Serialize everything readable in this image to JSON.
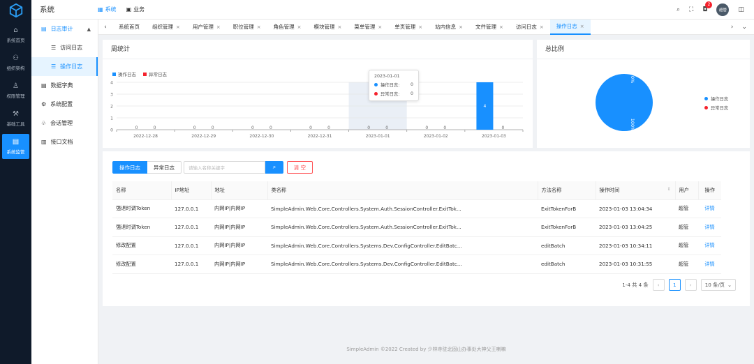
{
  "rail": {
    "items": [
      {
        "label": "系统首页",
        "icon": "home-icon",
        "glyph": "⌂"
      },
      {
        "label": "组织架构",
        "icon": "org-icon",
        "glyph": "⚇"
      },
      {
        "label": "权限管理",
        "icon": "user-icon",
        "glyph": "♙"
      },
      {
        "label": "基础工具",
        "icon": "wrench-icon",
        "glyph": "⚒"
      },
      {
        "label": "系统监管",
        "icon": "monitor-icon",
        "glyph": "▤"
      }
    ]
  },
  "header": {
    "title": "系统",
    "nav": [
      {
        "label": "系统",
        "glyph": "▦"
      },
      {
        "label": "业务",
        "glyph": "▣"
      }
    ],
    "notification_count": "2",
    "avatar_text": "超管"
  },
  "submenu": {
    "group": "日志审计",
    "subitems": [
      "访问日志",
      "操作日志"
    ],
    "items": [
      {
        "label": "数据字典",
        "glyph": "▤"
      },
      {
        "label": "系统配置",
        "glyph": "⚙"
      },
      {
        "label": "会话管理",
        "glyph": "♧"
      },
      {
        "label": "接口文档",
        "glyph": "▥"
      }
    ]
  },
  "tabs": [
    "系统首页",
    "组织管理",
    "用户管理",
    "职位管理",
    "角色管理",
    "模块管理",
    "菜单管理",
    "单页管理",
    "站内信息",
    "文件管理",
    "访问日志",
    "操作日志"
  ],
  "weekly": {
    "title": "周统计",
    "tooltip": {
      "date": "2023-01-01",
      "rows": [
        {
          "name": "操作日志:",
          "value": "0"
        },
        {
          "name": "异常日志:",
          "value": "0"
        }
      ]
    }
  },
  "ratio": {
    "title": "总比例"
  },
  "logs": {
    "tabs": [
      "操作日志",
      "异常日志"
    ],
    "search_placeholder": "请输入名称关键字",
    "clear_label": "清 空",
    "columns": [
      "名称",
      "IP地址",
      "地址",
      "类名称",
      "方法名称",
      "操作时间",
      "用户",
      "操作"
    ],
    "rows": [
      [
        "强退时调Token",
        "127.0.0.1",
        "内网IP|内网IP",
        "SimpleAdmin.Web.Core.Controllers.System.Auth.SessionController.ExitTok...",
        "ExitTokenForB",
        "2023-01-03 13:04:34",
        "超管",
        "详情"
      ],
      [
        "强退时调Token",
        "127.0.0.1",
        "内网IP|内网IP",
        "SimpleAdmin.Web.Core.Controllers.System.Auth.SessionController.ExitTok...",
        "ExitTokenForB",
        "2023-01-03 13:04:25",
        "超管",
        "详情"
      ],
      [
        "修改配置",
        "127.0.0.1",
        "内网IP|内网IP",
        "SimpleAdmin.Web.Core.Controllers.Systems.Dev.ConfigController.EditBatc...",
        "editBatch",
        "2023-01-03 10:34:11",
        "超管",
        "详情"
      ],
      [
        "修改配置",
        "127.0.0.1",
        "内网IP|内网IP",
        "SimpleAdmin.Web.Core.Controllers.Systems.Dev.ConfigController.EditBatc...",
        "editBatch",
        "2023-01-03 10:31:55",
        "超管",
        "详情"
      ]
    ],
    "pager": {
      "summary": "1-4 共 4 条",
      "page": "1",
      "page_size": "10 条/页"
    }
  },
  "footer": "SimpleAdmin ©2022 Created by 少林寺驻北固山办事处大神父王喇嘛",
  "colors": {
    "primary": "#1890ff",
    "danger": "#f5222d",
    "rail": "#0f1a2a"
  },
  "chart_data": [
    {
      "type": "bar",
      "categories": [
        "2022-12-28",
        "2022-12-29",
        "2022-12-30",
        "2022-12-31",
        "2023-01-01",
        "2023-01-02",
        "2023-01-03"
      ],
      "series": [
        {
          "name": "操作日志",
          "values": [
            0,
            0,
            0,
            0,
            0,
            0,
            4
          ]
        },
        {
          "name": "异常日志",
          "values": [
            0,
            0,
            0,
            0,
            0,
            0,
            0
          ]
        }
      ],
      "ylim": [
        0,
        4
      ],
      "yticks": [
        "0",
        "1",
        "2",
        "3",
        "4"
      ],
      "grid": true,
      "legend": "top-left",
      "title": "周统计"
    },
    {
      "type": "pie",
      "labels": [
        "操作日志",
        "异常日志"
      ],
      "values": [
        100,
        0
      ],
      "slice_labels": [
        "100%",
        "0%"
      ],
      "legend": "right",
      "title": "总比例"
    }
  ]
}
